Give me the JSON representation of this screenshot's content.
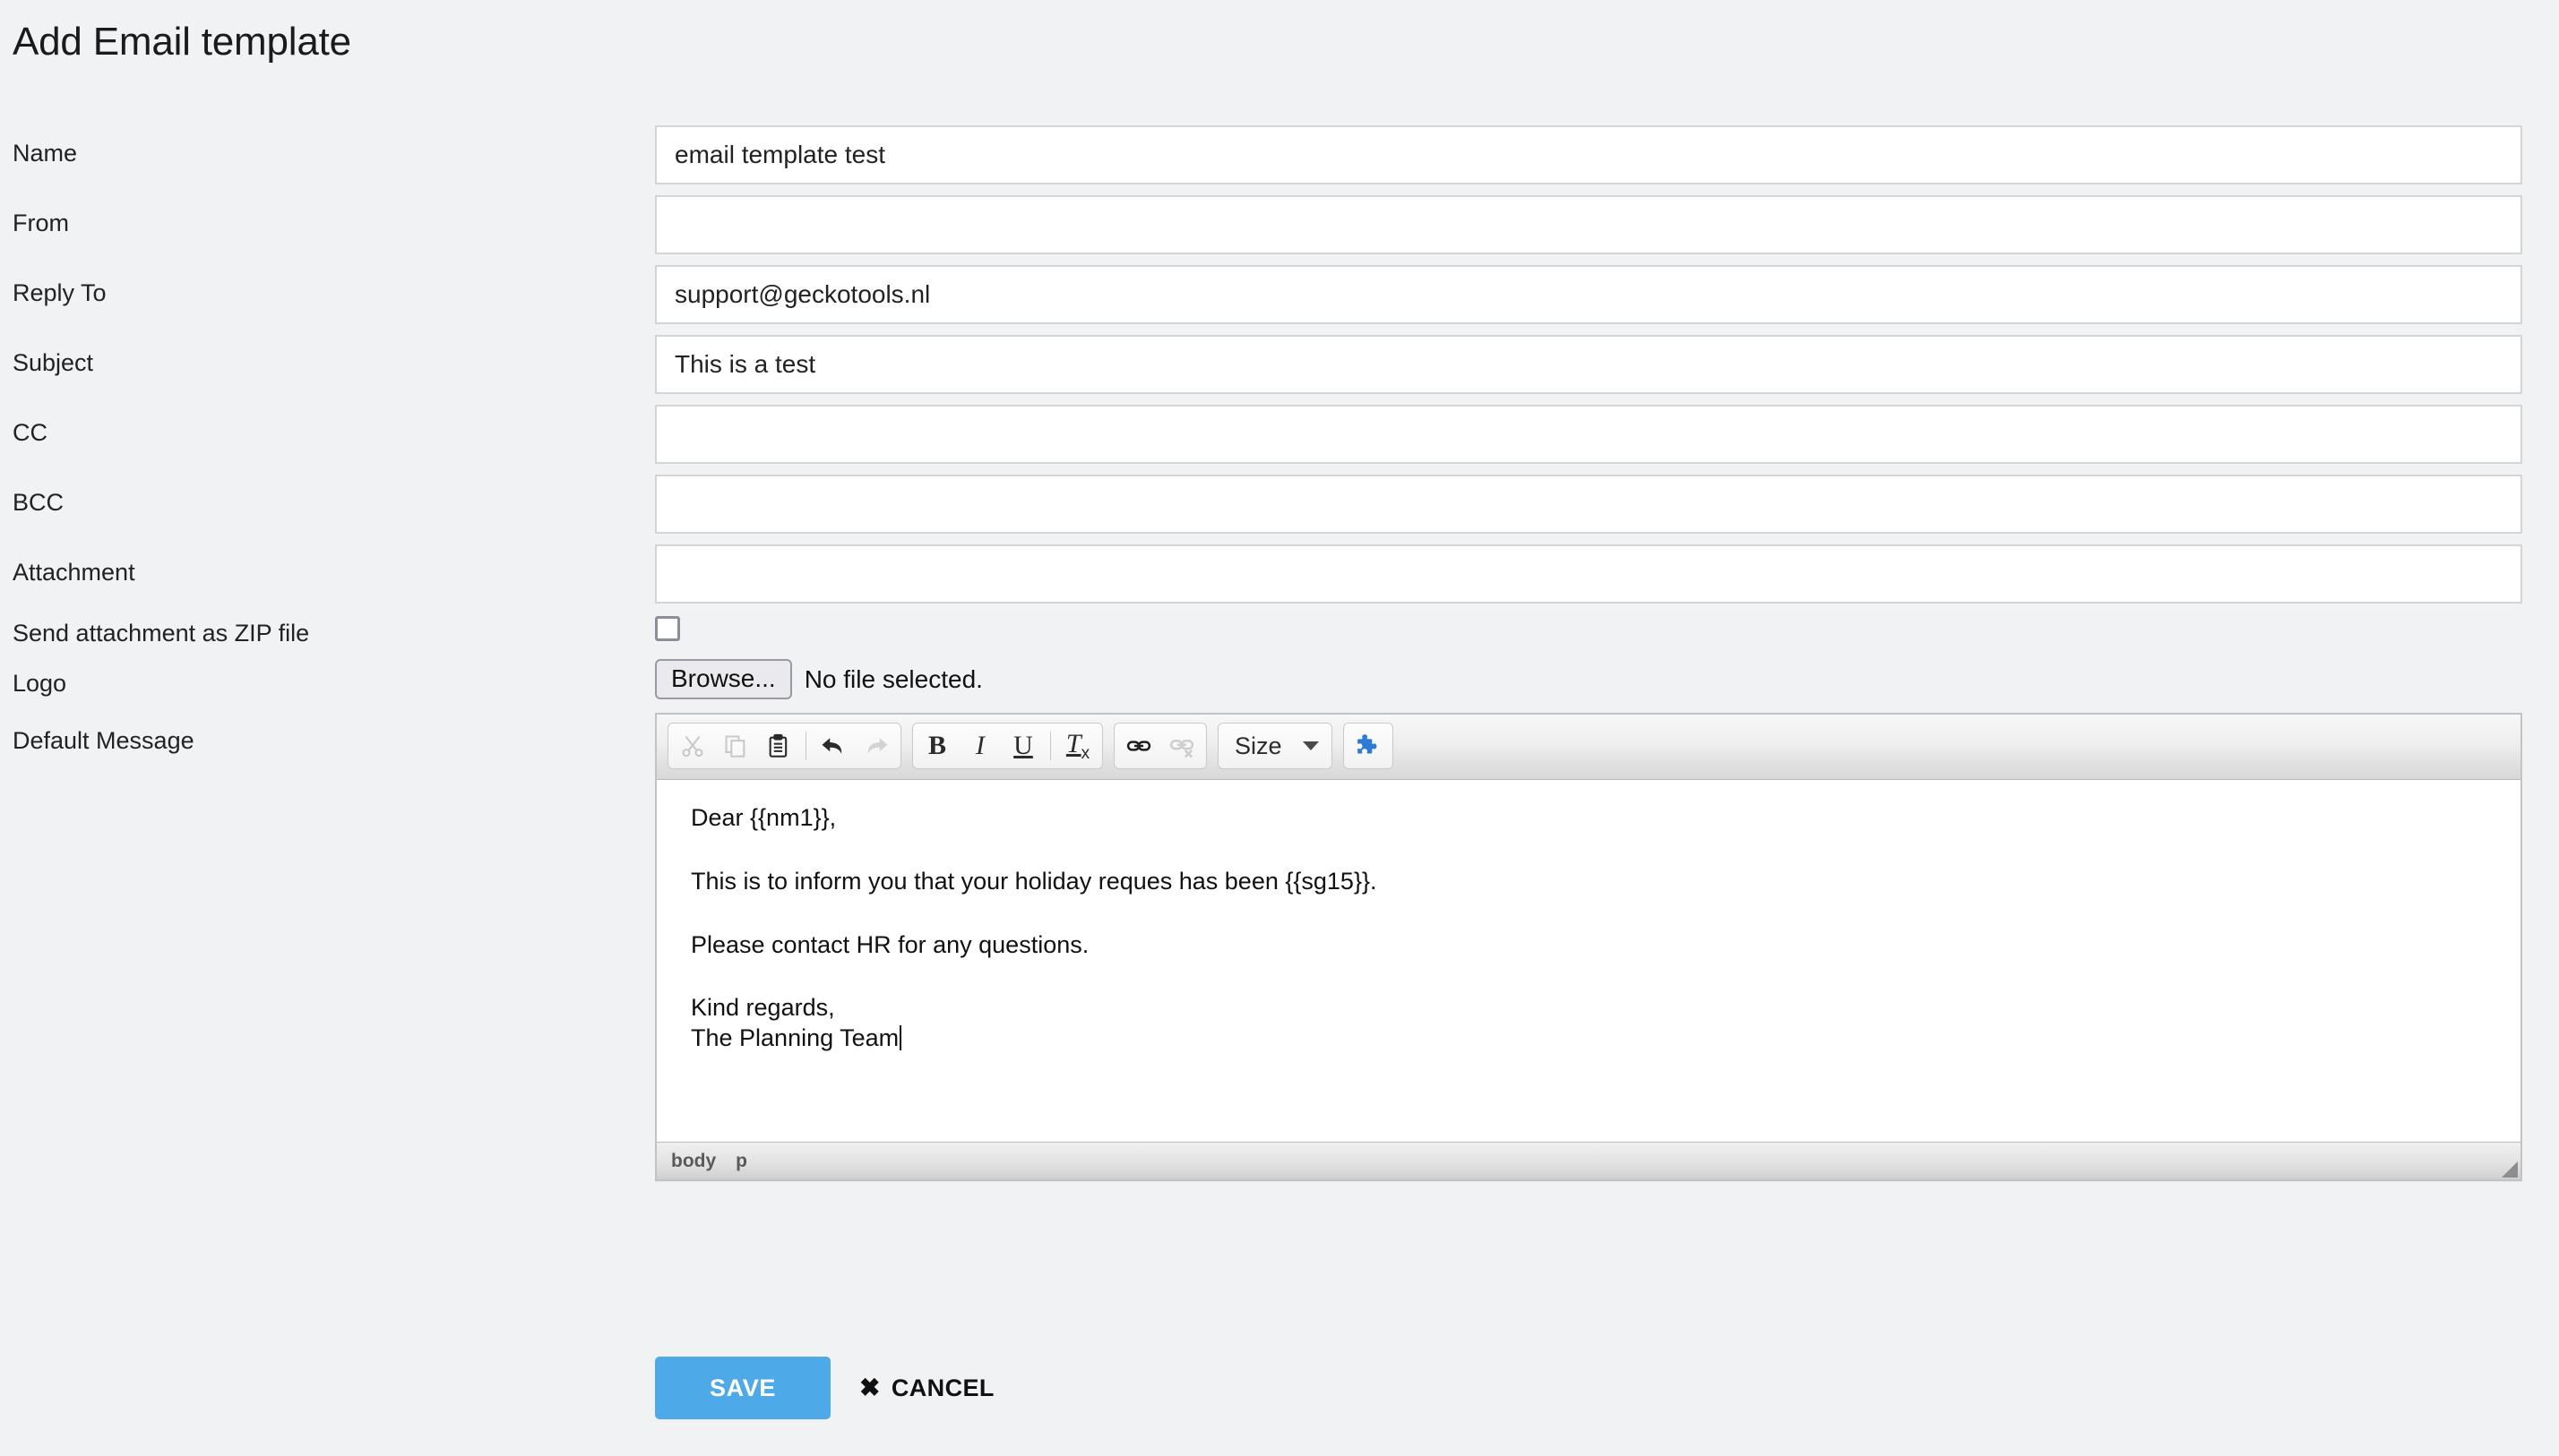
{
  "page": {
    "title": "Add Email template",
    "background_color": "#f0f2f4"
  },
  "fields": {
    "name": {
      "label": "Name",
      "value": "email template test",
      "placeholder": ""
    },
    "from": {
      "label": "From",
      "value": "",
      "placeholder": ""
    },
    "reply_to": {
      "label": "Reply To",
      "value": "support@geckotools.nl",
      "placeholder": ""
    },
    "subject": {
      "label": "Subject",
      "value": "This is a test",
      "placeholder": ""
    },
    "cc": {
      "label": "CC",
      "value": "",
      "placeholder": ""
    },
    "bcc": {
      "label": "BCC",
      "value": "",
      "placeholder": ""
    },
    "attachment": {
      "label": "Attachment",
      "value": "",
      "placeholder": ""
    },
    "zip": {
      "label": "Send attachment as ZIP file",
      "checked": false
    },
    "logo": {
      "label": "Logo",
      "browse_label": "Browse...",
      "file_status": "No file selected."
    },
    "default_message": {
      "label": "Default Message"
    }
  },
  "editor": {
    "toolbar": {
      "cut": "Cut",
      "copy": "Copy",
      "paste": "Paste",
      "undo": "Undo",
      "redo": "Redo",
      "bold": "B",
      "italic": "I",
      "underline": "U",
      "remove_format_main": "T",
      "remove_format_sub": "x",
      "link": "Link",
      "unlink": "Unlink",
      "size_label": "Size",
      "plugin": "Templates"
    },
    "content": {
      "line1": "Dear {{nm1}},",
      "line2": "This is to inform you that your holiday reques has been {{sg15}}.",
      "line3": "Please contact HR for any questions.",
      "line4": "Kind regards,",
      "line5": "The Planning Team"
    },
    "status_path": [
      "body",
      "p"
    ]
  },
  "footer": {
    "save_label": "SAVE",
    "cancel_label": "CANCEL",
    "cancel_icon": "✖",
    "save_color": "#4ea9e9"
  }
}
